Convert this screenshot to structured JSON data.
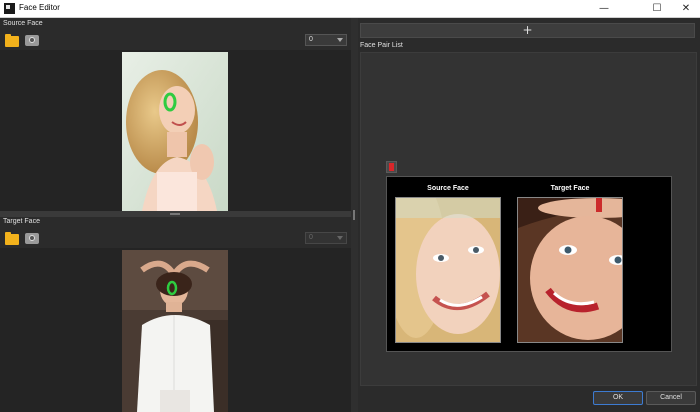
{
  "window": {
    "title": "Face Editor",
    "minimize_glyph": "—",
    "maximize_glyph": "☐",
    "close_glyph": "✕"
  },
  "source": {
    "label": "Source Face",
    "select_value": "0",
    "open_icon": "folder-icon",
    "camera_icon": "camera-icon"
  },
  "target": {
    "label": "Target Face",
    "select_value": "0",
    "open_icon": "folder-icon",
    "camera_icon": "camera-icon"
  },
  "pairs": {
    "add_glyph": "+",
    "list_label": "Face Pair List",
    "delete_icon": "trash-icon",
    "card": {
      "source_label": "Source Face",
      "target_label": "Target Face"
    }
  },
  "footer": {
    "ok_label": "OK",
    "cancel_label": "Cancel"
  },
  "colors": {
    "accent": "#3d7bd1",
    "folder": "#f3b21c",
    "delete": "#d9262a",
    "face_marker": "#2ecc40"
  }
}
